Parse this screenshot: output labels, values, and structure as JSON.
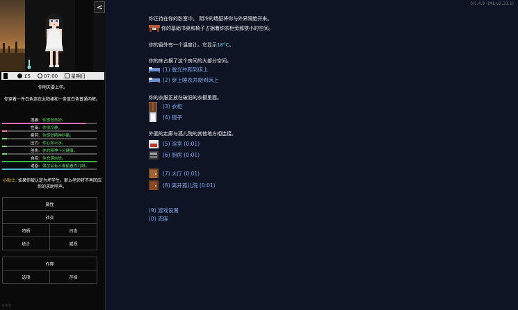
{
  "sidebar": {
    "toggle_label": "<",
    "status": {
      "money": "£5",
      "time": "07:00",
      "day": "星期日"
    },
    "note": "你明天要上学。",
    "description": "你穿着一件白色连衣太阳裙和一条蓝白色普通内裤。",
    "stats": [
      {
        "label": "淫痛:",
        "value": "你感觉良好。",
        "level": 0.88,
        "color": "#ff6fb5"
      },
      {
        "label": "性奋:",
        "value": "你很冷静。",
        "level": 0.05,
        "color": "#ff6fb5"
      },
      {
        "label": "疲劳:",
        "value": "你感觉精神抖擞。",
        "level": 0.05,
        "color": "#6bd96b"
      },
      {
        "label": "压力:",
        "value": "你心如止水。",
        "level": 0.05,
        "color": "#6bd96b"
      },
      {
        "label": "创伤:",
        "value": "你的精神十分健康。",
        "level": 0.05,
        "color": "#6bd96b"
      },
      {
        "label": "自控:",
        "value": "你充满自信。",
        "level": 1.0,
        "color": "#39b84a"
      },
      {
        "label": "诱惑:",
        "value": "偶尔会有人偷偷看你几眼。",
        "level": 0.82,
        "color": "#4fb6d8"
      }
    ],
    "tip_label": "小贴士:",
    "tip_text": "如果你被认定为坏学生，那么老师将不再回应你的求助呼声。",
    "menu1": {
      "attributes": "属性",
      "social": "社交",
      "traits": "特质",
      "journal": "日志",
      "statistics": "统计",
      "reputation": "威视"
    },
    "menu2": {
      "cheats": "作弊",
      "options": "选项",
      "saves": "存档"
    },
    "version": "0.4.9"
  },
  "main": {
    "version": "0.5.4.9 -(ML-v2.33.1)",
    "intro": "你正待在你的卧室中。 阴冷的墙壁将你与外界隔绝开来。",
    "furniture": "你的基础书桌和椅子占据着你衣柜旁那狭小的空间。",
    "window_prefix": "你的窗外有一个温度计。它显示",
    "window_temp": "18°C",
    "window_suffix": "。",
    "bed_text": "你的床占据了这个房间的大部分空间。",
    "bed_options": [
      "(1) 脱光并爬到床上",
      "(2) 穿上睡衣并爬到床上"
    ],
    "wardrobe_text": "你的衣服正放在破旧的衣橱里面。",
    "wardrobe_options": [
      "(3) 衣柜",
      "(4) 镜子"
    ],
    "hall_text": "外面的走廊与孤儿院的其他地方相连接。",
    "hall_options": [
      "(5) 浴室 (0:01)",
      "(6) 厨房 (0:01)",
      "(7) 大厅 (0:01)",
      "(8) 离开孤儿院 (0:01)"
    ],
    "system_options": [
      "(9) 游戏设置",
      "(0) 态度"
    ]
  }
}
